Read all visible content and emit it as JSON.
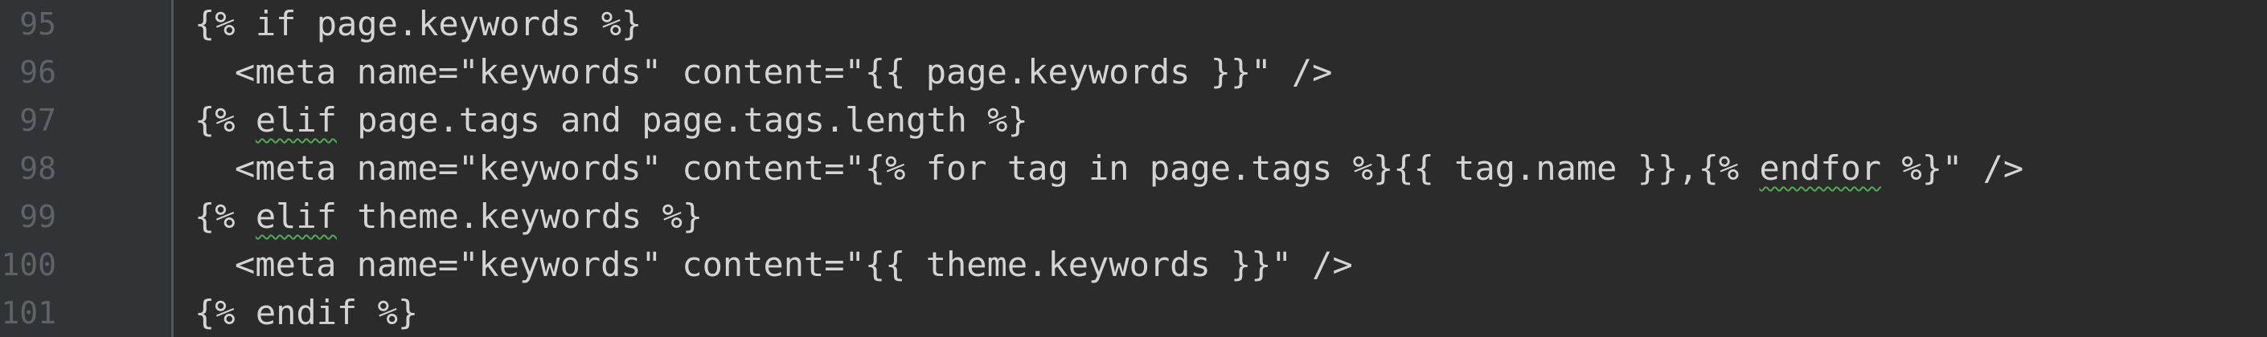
{
  "editor": {
    "lines": [
      {
        "number": "95",
        "text": "{% if page.keywords %}"
      },
      {
        "number": "96",
        "text": "<meta name=\"keywords\" content=\"{{ page.keywords }}\" />"
      },
      {
        "number": "97",
        "pre": "{% ",
        "squiggle": "elif",
        "post": " page.tags and page.tags.length %}"
      },
      {
        "number": "98",
        "pre": "<meta name=\"keywords\" content=\"{% for tag in page.tags %}{{ tag.name }},{% ",
        "squiggle": "endfor",
        "post": " %}\" />"
      },
      {
        "number": "99",
        "pre": "{% ",
        "squiggle": "elif",
        "post": " theme.keywords %}"
      },
      {
        "number": "100",
        "text": "<meta name=\"keywords\" content=\"{{ theme.keywords }}\" />"
      },
      {
        "number": "101",
        "text": "{% endif %}"
      }
    ]
  }
}
